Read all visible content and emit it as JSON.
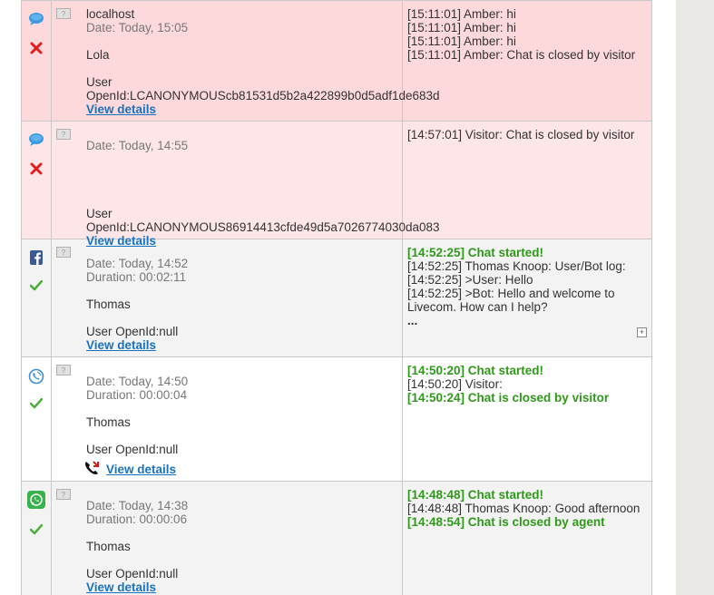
{
  "view_details_label": "View details",
  "thumb_label": "?",
  "expand_label": "+",
  "rows": [
    {
      "host": "localhost",
      "date": "Date: Today, 15:05",
      "name": "Lola",
      "user_line1": "User",
      "user_line2": "OpenId:LCANONYMOUScb81531d5b2a422899b0d5adf1de683d",
      "channel_icon": "chat-bubble-icon",
      "status_icon": "red-x-icon",
      "log": [
        {
          "text": "[15:11:01] Amber: hi",
          "style": "normal"
        },
        {
          "text": "[15:11:01] Amber: hi",
          "style": "normal"
        },
        {
          "text": "[15:11:01] Amber: hi",
          "style": "normal"
        },
        {
          "text": "[15:11:01] Amber: Chat is closed by visitor",
          "style": "normal"
        }
      ]
    },
    {
      "date": "Date: Today, 14:55",
      "user_line1": "User",
      "user_line2": "OpenId:LCANONYMOUS86914413cfde49d5a7026774030da083",
      "channel_icon": "chat-bubble-icon",
      "status_icon": "red-x-icon",
      "log": [
        {
          "text": "[14:57:01] Visitor: Chat is closed by visitor",
          "style": "normal"
        }
      ]
    },
    {
      "date": "Date: Today, 14:52",
      "duration": "Duration: 00:02:11",
      "name": "Thomas",
      "user_line1": "User OpenId:null",
      "channel_icon": "facebook-icon",
      "status_icon": "green-check-icon",
      "log": [
        {
          "text": "[14:52:25] Chat started!",
          "style": "green"
        },
        {
          "text": "[14:52:25] Thomas Knoop: User/Bot log:",
          "style": "normal"
        },
        {
          "text": "[14:52:25] >User: Hello",
          "style": "normal"
        },
        {
          "text": "[14:52:25] >Bot: Hello and welcome to",
          "style": "normal"
        },
        {
          "text": "Livecom. How can I help?",
          "style": "normal"
        }
      ],
      "ellipsis": "..."
    },
    {
      "date": "Date: Today, 14:50",
      "duration": "Duration: 00:00:04",
      "name": "Thomas",
      "user_line1": "User OpenId:null",
      "channel_icon": "viber-icon",
      "status_icon": "green-check-icon",
      "log": [
        {
          "text": "[14:50:20] Chat started!",
          "style": "green"
        },
        {
          "text": "[14:50:20] Visitor:",
          "style": "normal"
        },
        {
          "text": "[14:50:24] Chat is closed by visitor",
          "style": "green"
        }
      ]
    },
    {
      "date": "Date: Today, 14:38",
      "duration": "Duration: 00:00:06",
      "name": "Thomas",
      "user_line1": "User OpenId:null",
      "channel_icon": "whatsapp-icon",
      "status_icon": "green-check-icon",
      "log": [
        {
          "text": "[14:48:48] Chat started!",
          "style": "green"
        },
        {
          "text": "[14:48:48] Thomas Knoop: Good afternoon",
          "style": "normal"
        },
        {
          "text": "[14:48:54] Chat is closed by agent",
          "style": "green"
        }
      ]
    }
  ]
}
